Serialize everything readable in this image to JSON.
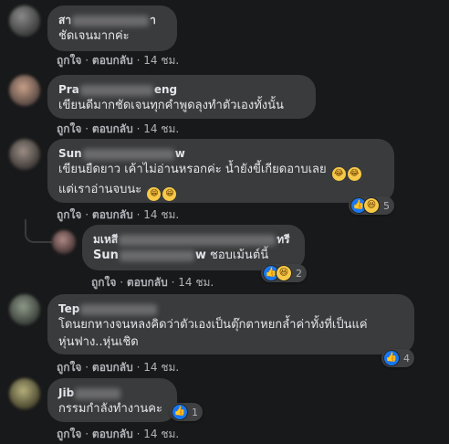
{
  "actions": {
    "like": "ถูกใจ",
    "reply": "ตอบกลับ",
    "separator": "·",
    "time": "14 ชม."
  },
  "comments": [
    {
      "name_visible_start": "สา",
      "name_visible_end": "า",
      "text_lines": [
        "ชัดเจนมากค่ะ"
      ]
    },
    {
      "name_visible_start": "Pra",
      "name_visible_end": "eng",
      "text_lines": [
        "เขียนดีมากชัดเจนทุกคำพูดลุงทำตัวเองทั้งนั้น"
      ]
    },
    {
      "name_visible_start": "Sun",
      "name_visible_end": "w",
      "text_lines": [
        "เขียนยืดยาว เค้าไม่อ่านหรอกค่ะ น้ำยังขี้เกียดอาบเลย",
        "แต่เราอ่านจบนะ"
      ],
      "reactions": {
        "count": "5",
        "types": [
          "like-icon",
          "haha-icon"
        ]
      }
    },
    {
      "name_visible_start": "มเหสี",
      "name_visible_end": "ทรี",
      "text_tag_start": "Sun",
      "text_tag_end": "w",
      "text_rest": "ชอบเม้นต์นี้",
      "reactions": {
        "count": "2",
        "types": [
          "like-icon",
          "haha-icon"
        ]
      }
    },
    {
      "name_visible_start": "Tep",
      "name_visible_end": "",
      "text_lines": [
        "โดนยกหางจนหลงคิดว่าตัวเองเป็นตุ๊กตาหยกล้ำค่าทั้งที่เป็นแค่",
        "หุ่นฟาง..หุ่นเชิด"
      ],
      "reactions": {
        "count": "4",
        "types": [
          "like-icon"
        ]
      }
    },
    {
      "name_visible_start": "Jib",
      "name_visible_end": "",
      "text_lines": [
        "กรรมกำลังทำงานคะ"
      ],
      "reactions": {
        "count": "1",
        "types": [
          "like-icon"
        ]
      }
    }
  ],
  "colors": {
    "background": "#18191a",
    "bubble": "#3a3b3c",
    "text": "#e4e6eb",
    "muted": "#b0b3b8",
    "like": "#1877f2",
    "haha": "#f7c948"
  }
}
